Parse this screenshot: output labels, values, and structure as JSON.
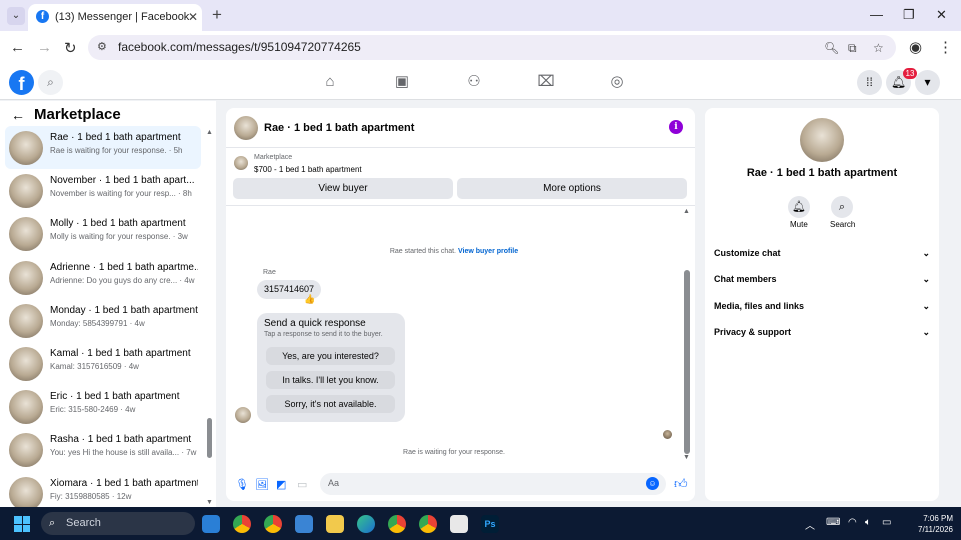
{
  "browser": {
    "tab_title": "(13) Messenger | Facebook",
    "url": "facebook.com/messages/t/951094720774265"
  },
  "fb": {
    "notification_count": "13"
  },
  "sidebar": {
    "title": "Marketplace",
    "conversations": [
      {
        "name": "Rae · 1 bed 1 bath apartment",
        "preview": "Rae is waiting for your response. · 5h"
      },
      {
        "name": "November · 1 bed 1 bath apart...",
        "preview": "November is waiting for your resp... · 8h"
      },
      {
        "name": "Molly · 1 bed 1 bath apartment",
        "preview": "Molly is waiting for your response. · 3w"
      },
      {
        "name": "Adrienne · 1 bed 1 bath apartme...",
        "preview": "Adrienne: Do you guys do any cre... · 4w"
      },
      {
        "name": "Monday · 1 bed 1 bath apartment",
        "preview": "Monday: 5854399791 · 4w"
      },
      {
        "name": "Kamal · 1 bed 1 bath apartment",
        "preview": "Kamal: 3157616509 · 4w"
      },
      {
        "name": "Eric · 1 bed 1 bath apartment",
        "preview": "Eric: 315-580-2469 · 4w"
      },
      {
        "name": "Rasha · 1 bed 1 bath apartment",
        "preview": "You: yes Hi the house is still availa... · 7w"
      },
      {
        "name": "Xiomara · 1 bed 1 bath apartment",
        "preview": "Fiy: 3159880585 · 12w"
      }
    ]
  },
  "chat": {
    "title": "Rae · 1 bed 1 bath apartment",
    "marketplace_label": "Marketplace",
    "listing": "$700 - 1 bed 1 bath apartment",
    "view_buyer": "View buyer",
    "more_options": "More options",
    "started_text": "Rae started this chat.",
    "view_buyer_profile": "View buyer profile",
    "sender_name": "Rae",
    "message": "3157414607",
    "reaction": "👍",
    "quick_response": {
      "title": "Send a quick response",
      "subtitle": "Tap a response to send it to the buyer.",
      "options": [
        "Yes, are you interested?",
        "In talks. I'll let you know.",
        "Sorry, it's not available."
      ]
    },
    "waiting_text": "Rae is waiting for your response.",
    "composer_placeholder": "Aa"
  },
  "right_panel": {
    "name": "Rae · 1 bed 1 bath apartment",
    "mute_label": "Mute",
    "search_label": "Search",
    "sections": [
      "Customize chat",
      "Chat members",
      "Media, files and links",
      "Privacy & support"
    ]
  },
  "taskbar": {
    "search_label": "Search",
    "time": "7:06 PM",
    "date": "7/11/2026"
  },
  "colors": {
    "fb_blue": "#1877f2",
    "accent": "#0866ff",
    "info_purple": "#8f00d8",
    "badge_red": "#e41e3f"
  }
}
